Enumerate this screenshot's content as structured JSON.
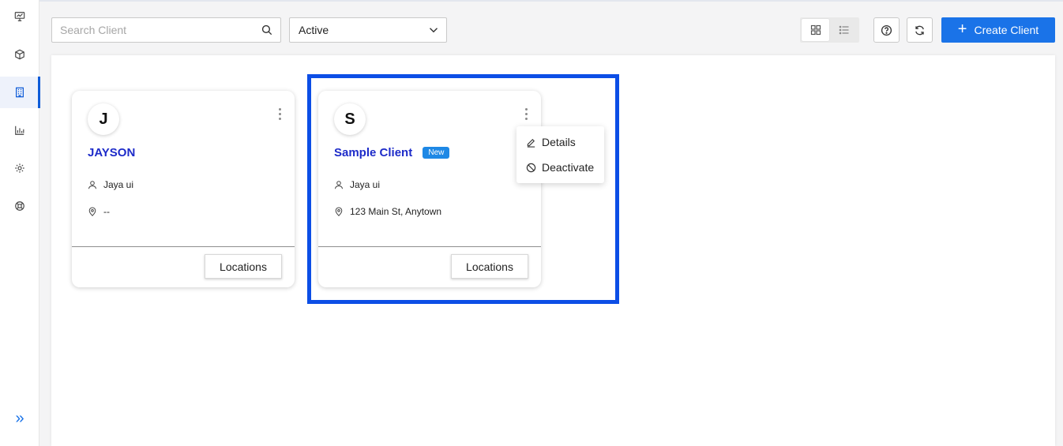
{
  "sidebar": {
    "items": [
      {
        "name": "dashboard",
        "icon": "presentation-chart-icon"
      },
      {
        "name": "products",
        "icon": "cube-icon"
      },
      {
        "name": "clients",
        "icon": "building-icon",
        "active": true
      },
      {
        "name": "reports",
        "icon": "bar-chart-icon"
      },
      {
        "name": "settings",
        "icon": "gear-icon"
      },
      {
        "name": "support",
        "icon": "lifebuoy-icon"
      }
    ],
    "expand_glyph": "»"
  },
  "toolbar": {
    "search_placeholder": "Search Client",
    "search_value": "",
    "status_selected": "Active",
    "create_label": "Create Client",
    "create_glyph": "+"
  },
  "clients": [
    {
      "initial": "J",
      "name": "JAYSON",
      "badge": "",
      "owner": "Jaya ui",
      "address": "--",
      "locations_label": "Locations"
    },
    {
      "initial": "S",
      "name": "Sample Client",
      "badge": "New",
      "owner": "Jaya ui",
      "address": "123 Main St, Anytown",
      "locations_label": "Locations"
    }
  ],
  "menu": {
    "details_label": "Details",
    "deactivate_label": "Deactivate"
  },
  "colors": {
    "accent": "#1a73e8",
    "client_name": "#1d2bc9",
    "badge": "#1e88e5",
    "highlight": "#0c4ee6"
  }
}
